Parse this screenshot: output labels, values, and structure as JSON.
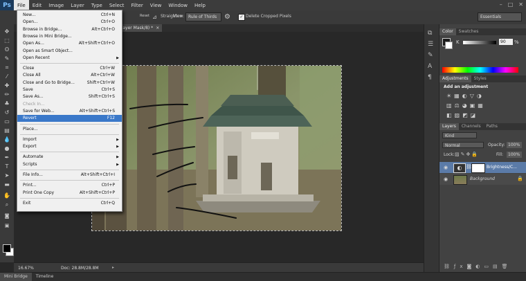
{
  "menubar": {
    "logo": "Ps",
    "items": [
      "File",
      "Edit",
      "Image",
      "Layer",
      "Type",
      "Select",
      "Filter",
      "View",
      "Window",
      "Help"
    ],
    "active": "File"
  },
  "optbar": {
    "straighten": "Straighten",
    "view_label": "View:",
    "view_value": "Rule of Thirds",
    "delete_cropped": "Delete Cropped Pixels",
    "workspace": "Essentials",
    "reset_fragment": "Reset"
  },
  "doc_tab": {
    "title": "Layer Mask/8) *",
    "close": "×"
  },
  "status": {
    "zoom": "16.67%",
    "doc": "Doc: 28.8M/28.8M"
  },
  "bottom_tabs": [
    "Mini Bridge",
    "Timeline"
  ],
  "file_menu": [
    {
      "label": "New...",
      "shortcut": "Ctrl+N"
    },
    {
      "label": "Open...",
      "shortcut": "Ctrl+O"
    },
    {
      "label": "Browse in Bridge...",
      "shortcut": "Alt+Ctrl+O"
    },
    {
      "label": "Browse in Mini Bridge...",
      "shortcut": ""
    },
    {
      "label": "Open As...",
      "shortcut": "Alt+Shift+Ctrl+O"
    },
    {
      "label": "Open as Smart Object...",
      "shortcut": ""
    },
    {
      "label": "Open Recent",
      "shortcut": "",
      "submenu": true
    },
    {
      "sep": true
    },
    {
      "label": "Close",
      "shortcut": "Ctrl+W"
    },
    {
      "label": "Close All",
      "shortcut": "Alt+Ctrl+W"
    },
    {
      "label": "Close and Go to Bridge...",
      "shortcut": "Shift+Ctrl+W"
    },
    {
      "label": "Save",
      "shortcut": "Ctrl+S"
    },
    {
      "label": "Save As...",
      "shortcut": "Shift+Ctrl+S"
    },
    {
      "label": "Check In...",
      "shortcut": "",
      "disabled": true
    },
    {
      "label": "Save for Web...",
      "shortcut": "Alt+Shift+Ctrl+S"
    },
    {
      "label": "Revert",
      "shortcut": "F12",
      "highlight": true
    },
    {
      "sep": true
    },
    {
      "label": "Place...",
      "shortcut": ""
    },
    {
      "sep": true
    },
    {
      "label": "Import",
      "shortcut": "",
      "submenu": true
    },
    {
      "label": "Export",
      "shortcut": "",
      "submenu": true
    },
    {
      "sep": true
    },
    {
      "label": "Automate",
      "shortcut": "",
      "submenu": true
    },
    {
      "label": "Scripts",
      "shortcut": "",
      "submenu": true
    },
    {
      "sep": true
    },
    {
      "label": "File Info...",
      "shortcut": "Alt+Shift+Ctrl+I"
    },
    {
      "sep": true
    },
    {
      "label": "Print...",
      "shortcut": "Ctrl+P"
    },
    {
      "label": "Print One Copy",
      "shortcut": "Alt+Shift+Ctrl+P"
    },
    {
      "sep": true
    },
    {
      "label": "Exit",
      "shortcut": "Ctrl+Q"
    }
  ],
  "color_panel": {
    "tabs": [
      "Color",
      "Swatches"
    ],
    "k_label": "K",
    "k_value": "90",
    "k_unit": "%"
  },
  "adjust_panel": {
    "tabs": [
      "Adjustments",
      "Styles"
    ],
    "heading": "Add an adjustment"
  },
  "layers_panel": {
    "tabs": [
      "Layers",
      "Channels",
      "Paths"
    ],
    "kind": "Kind",
    "blend": "Normal",
    "opacity_label": "Opacity:",
    "opacity": "100%",
    "lock_label": "Lock:",
    "fill_label": "Fill:",
    "fill": "100%",
    "layers": [
      {
        "name": "Brightness/C..."
      },
      {
        "name": "Background"
      }
    ]
  }
}
